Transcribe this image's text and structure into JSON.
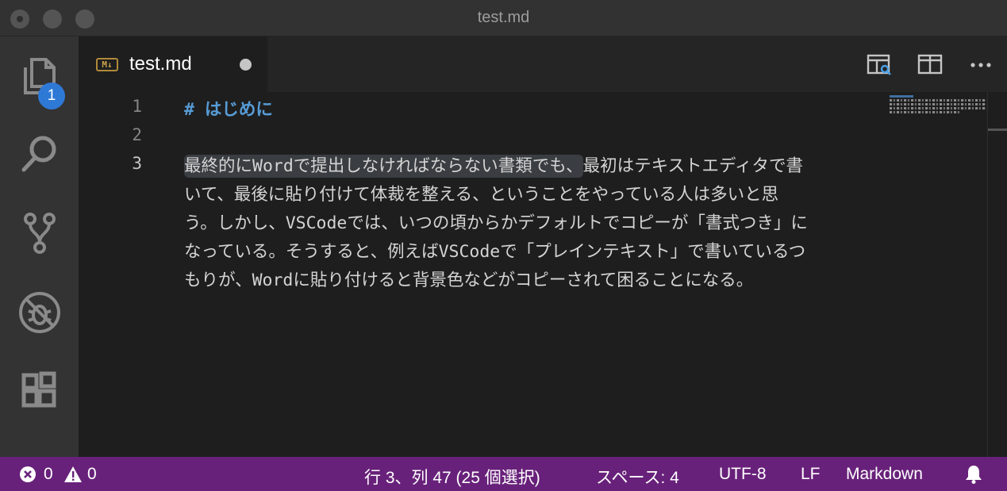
{
  "window": {
    "title": "test.md"
  },
  "activity_bar": {
    "items": [
      {
        "name": "explorer",
        "icon": "files-icon",
        "badge": "1"
      },
      {
        "name": "search",
        "icon": "search-icon"
      },
      {
        "name": "source-control",
        "icon": "source-control-icon"
      },
      {
        "name": "debug",
        "icon": "debug-disabled-icon"
      },
      {
        "name": "extensions",
        "icon": "extensions-icon"
      }
    ]
  },
  "tabs": [
    {
      "label": "test.md",
      "icon": "markdown-icon",
      "dirty": true
    }
  ],
  "editor_actions": [
    "open-preview-icon",
    "split-editor-icon",
    "more-actions-icon"
  ],
  "editor": {
    "line_numbers": [
      "1",
      "2",
      "3"
    ],
    "line1": {
      "hash": "#",
      "heading": "はじめに"
    },
    "line3_wrapped": [
      {
        "selected": "最終的にWordで提出しなければならない書類でも、",
        "rest": "最初はテキストエディタで書"
      },
      {
        "text": "いて、最後に貼り付けて体裁を整える、ということをやっている人は多いと思"
      },
      {
        "text": "う。しかし、VSCodeでは、いつの頃からかデフォルトでコピーが「書式つき」に"
      },
      {
        "text": "なっている。そうすると、例えばVSCodeで「プレインテキスト」で書いているつ"
      },
      {
        "text": "もりが、Wordに貼り付けると背景色などがコピーされて困ることになる。"
      }
    ]
  },
  "status_bar": {
    "errors": "0",
    "warnings": "0",
    "cursor": "行 3、列 47 (25 個選択)",
    "indent": "スペース: 4",
    "encoding": "UTF-8",
    "eol": "LF",
    "language": "Markdown",
    "colors": {
      "background": "#68217a"
    }
  }
}
